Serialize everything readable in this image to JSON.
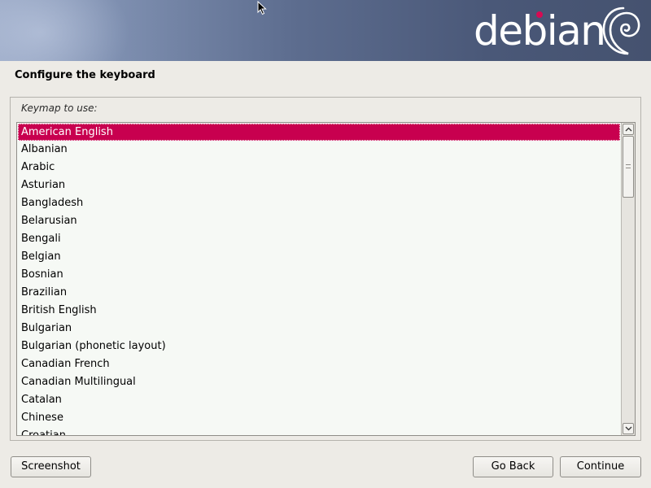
{
  "header": {
    "logo_text": "debian"
  },
  "page": {
    "title": "Configure the keyboard"
  },
  "keymap": {
    "label": "Keymap to use:",
    "selected": "American English",
    "items": [
      "American English",
      "Albanian",
      "Arabic",
      "Asturian",
      "Bangladesh",
      "Belarusian",
      "Bengali",
      "Belgian",
      "Bosnian",
      "Brazilian",
      "British English",
      "Bulgarian",
      "Bulgarian (phonetic layout)",
      "Canadian French",
      "Canadian Multilingual",
      "Catalan",
      "Chinese",
      "Croatian"
    ]
  },
  "buttons": {
    "screenshot": "Screenshot",
    "go_back": "Go Back",
    "continue": "Continue"
  },
  "colors": {
    "selection": "#c8004f",
    "logo_dot": "#d70a53",
    "banner_dark": "#45526f"
  },
  "icons": {
    "scroll_up": "chevron-up-icon",
    "scroll_down": "chevron-down-icon",
    "logo_swirl": "debian-swirl-icon",
    "cursor": "mouse-pointer-icon"
  }
}
